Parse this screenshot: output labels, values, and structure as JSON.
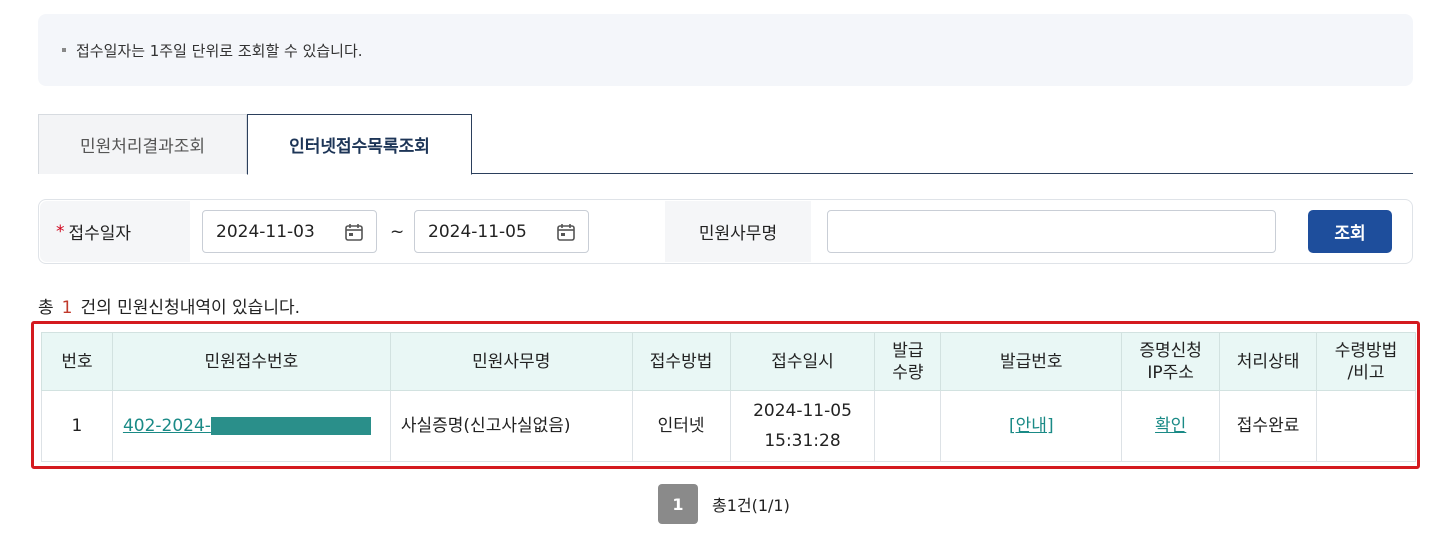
{
  "notice": {
    "text": "접수일자는 1주일 단위로 조회할 수 있습니다."
  },
  "tabs": [
    {
      "label": "민원처리결과조회",
      "active": false
    },
    {
      "label": "인터넷접수목록조회",
      "active": true
    }
  ],
  "search": {
    "date_label": "접수일자",
    "required_mark": "*",
    "start_date": "2024-11-03",
    "tilde": "~",
    "end_date": "2024-11-05",
    "office_label": "민원사무명",
    "office_value": "",
    "button_label": "조회"
  },
  "summary": {
    "prefix": "총",
    "count": "1",
    "suffix": "건의 민원신청내역이 있습니다."
  },
  "table": {
    "headers": [
      "번호",
      "민원접수번호",
      "민원사무명",
      "접수방법",
      "접수일시",
      "발급\n수량",
      "발급번호",
      "증명신청\nIP주소",
      "처리상태",
      "수령방법\n/비고"
    ],
    "rows": [
      {
        "no": "1",
        "receipt_no": "402-2024-",
        "office": "사실증명(신고사실없음)",
        "method": "인터넷",
        "date": "2024-11-05",
        "time": "15:31:28",
        "qty": "",
        "issue_no": "[안내]",
        "ip": "확인",
        "status": "접수완료",
        "note": ""
      }
    ]
  },
  "pager": {
    "current": "1",
    "total_text": "총1건(1/1)"
  },
  "colors": {
    "accent": "#1e4e9c",
    "link": "#1a8a86",
    "highlight_border": "#d41a1f",
    "header_bg": "#e9f7f5"
  }
}
